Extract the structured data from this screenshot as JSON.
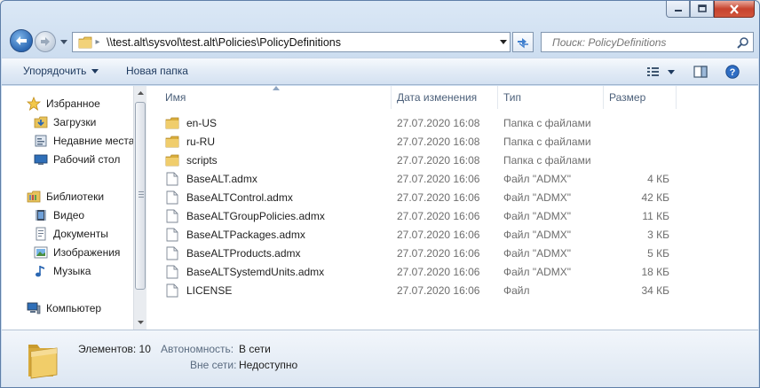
{
  "window": {
    "minimize_icon": "minimize-icon",
    "maximize_icon": "maximize-icon",
    "close_icon": "close-icon"
  },
  "address": {
    "path": "\\\\test.alt\\sysvol\\test.alt\\Policies\\PolicyDefinitions",
    "separator": "▸"
  },
  "search": {
    "placeholder": "Поиск: PolicyDefinitions"
  },
  "toolbar": {
    "organize_label": "Упорядочить",
    "new_folder_label": "Новая папка"
  },
  "sidebar": {
    "favorites": {
      "label": "Избранное",
      "items": [
        {
          "label": "Загрузки",
          "icon": "downloads-icon"
        },
        {
          "label": "Недавние места",
          "icon": "recent-places-icon"
        },
        {
          "label": "Рабочий стол",
          "icon": "desktop-icon"
        }
      ]
    },
    "libraries": {
      "label": "Библиотеки",
      "items": [
        {
          "label": "Видео",
          "icon": "video-icon"
        },
        {
          "label": "Документы",
          "icon": "documents-icon"
        },
        {
          "label": "Изображения",
          "icon": "pictures-icon"
        },
        {
          "label": "Музыка",
          "icon": "music-icon"
        }
      ]
    },
    "computer": {
      "label": "Компьютер"
    }
  },
  "columns": {
    "name": "Имя",
    "date": "Дата изменения",
    "type": "Тип",
    "size": "Размер"
  },
  "files": [
    {
      "name": "en-US",
      "date": "27.07.2020 16:08",
      "type": "Папка с файлами",
      "size": "",
      "kind": "folder"
    },
    {
      "name": "ru-RU",
      "date": "27.07.2020 16:08",
      "type": "Папка с файлами",
      "size": "",
      "kind": "folder"
    },
    {
      "name": "scripts",
      "date": "27.07.2020 16:08",
      "type": "Папка с файлами",
      "size": "",
      "kind": "folder"
    },
    {
      "name": "BaseALT.admx",
      "date": "27.07.2020 16:06",
      "type": "Файл \"ADMX\"",
      "size": "4 КБ",
      "kind": "file"
    },
    {
      "name": "BaseALTControl.admx",
      "date": "27.07.2020 16:06",
      "type": "Файл \"ADMX\"",
      "size": "42 КБ",
      "kind": "file"
    },
    {
      "name": "BaseALTGroupPolicies.admx",
      "date": "27.07.2020 16:06",
      "type": "Файл \"ADMX\"",
      "size": "11 КБ",
      "kind": "file"
    },
    {
      "name": "BaseALTPackages.admx",
      "date": "27.07.2020 16:06",
      "type": "Файл \"ADMX\"",
      "size": "3 КБ",
      "kind": "file"
    },
    {
      "name": "BaseALTProducts.admx",
      "date": "27.07.2020 16:06",
      "type": "Файл \"ADMX\"",
      "size": "5 КБ",
      "kind": "file"
    },
    {
      "name": "BaseALTSystemdUnits.admx",
      "date": "27.07.2020 16:06",
      "type": "Файл \"ADMX\"",
      "size": "18 КБ",
      "kind": "file"
    },
    {
      "name": "LICENSE",
      "date": "27.07.2020 16:06",
      "type": "Файл",
      "size": "34 КБ",
      "kind": "file"
    }
  ],
  "details": {
    "count_label": "Элементов: 10",
    "offline_availability_label": "Автономность:",
    "offline_availability_value": "В сети",
    "offline_label": "Вне сети:",
    "offline_value": "Недоступно"
  },
  "colors": {
    "accent": "#2b67b2",
    "folder_yellow": "#e8c35a"
  }
}
